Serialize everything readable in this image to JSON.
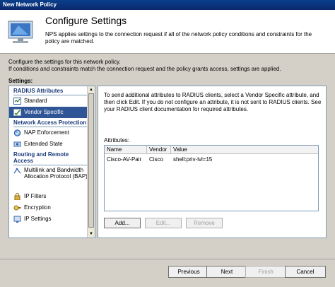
{
  "window": {
    "title": "New Network Policy"
  },
  "header": {
    "title": "Configure Settings",
    "description": "NPS applies settings to the connection request if all of the network policy conditions and constraints for the policy are matched."
  },
  "intro": {
    "line1": "Configure the settings for this network policy.",
    "line2": "If conditions and constraints match the connection request and the policy grants access, settings are applied."
  },
  "settings_label": "Settings:",
  "sidebar": {
    "groups": [
      {
        "title": "RADIUS Attributes",
        "items": [
          "Standard",
          "Vendor Specific"
        ]
      },
      {
        "title": "Network Access Protection",
        "items": [
          "NAP Enforcement",
          "Extended State"
        ]
      },
      {
        "title": "Routing and Remote Access",
        "items": [
          "Multilink and Bandwidth Allocation Protocol (BAP)",
          "IP Filters",
          "Encryption",
          "IP Settings"
        ]
      }
    ],
    "selected": "Vendor Specific"
  },
  "content": {
    "paragraph": "To send additional attributes to RADIUS clients, select a Vendor Specific attribute, and then click Edit. If you do not configure an attribute, it is not sent to RADIUS clients. See your RADIUS client documentation for required attributes.",
    "attributes_label": "Attributes:",
    "columns": [
      "Name",
      "Vendor",
      "Value"
    ],
    "rows": [
      {
        "name": "Cisco-AV-Pair",
        "vendor": "Cisco",
        "value": "shell:priv-lvl=15"
      }
    ],
    "buttons": {
      "add": "Add...",
      "edit": "Edit...",
      "remove": "Remove"
    }
  },
  "footer": {
    "previous": "Previous",
    "next": "Next",
    "finish": "Finish",
    "cancel": "Cancel"
  },
  "colors": {
    "titlebar": "#0a2a6e",
    "selection": "#2f5597",
    "group_text": "#1a3a7a"
  }
}
